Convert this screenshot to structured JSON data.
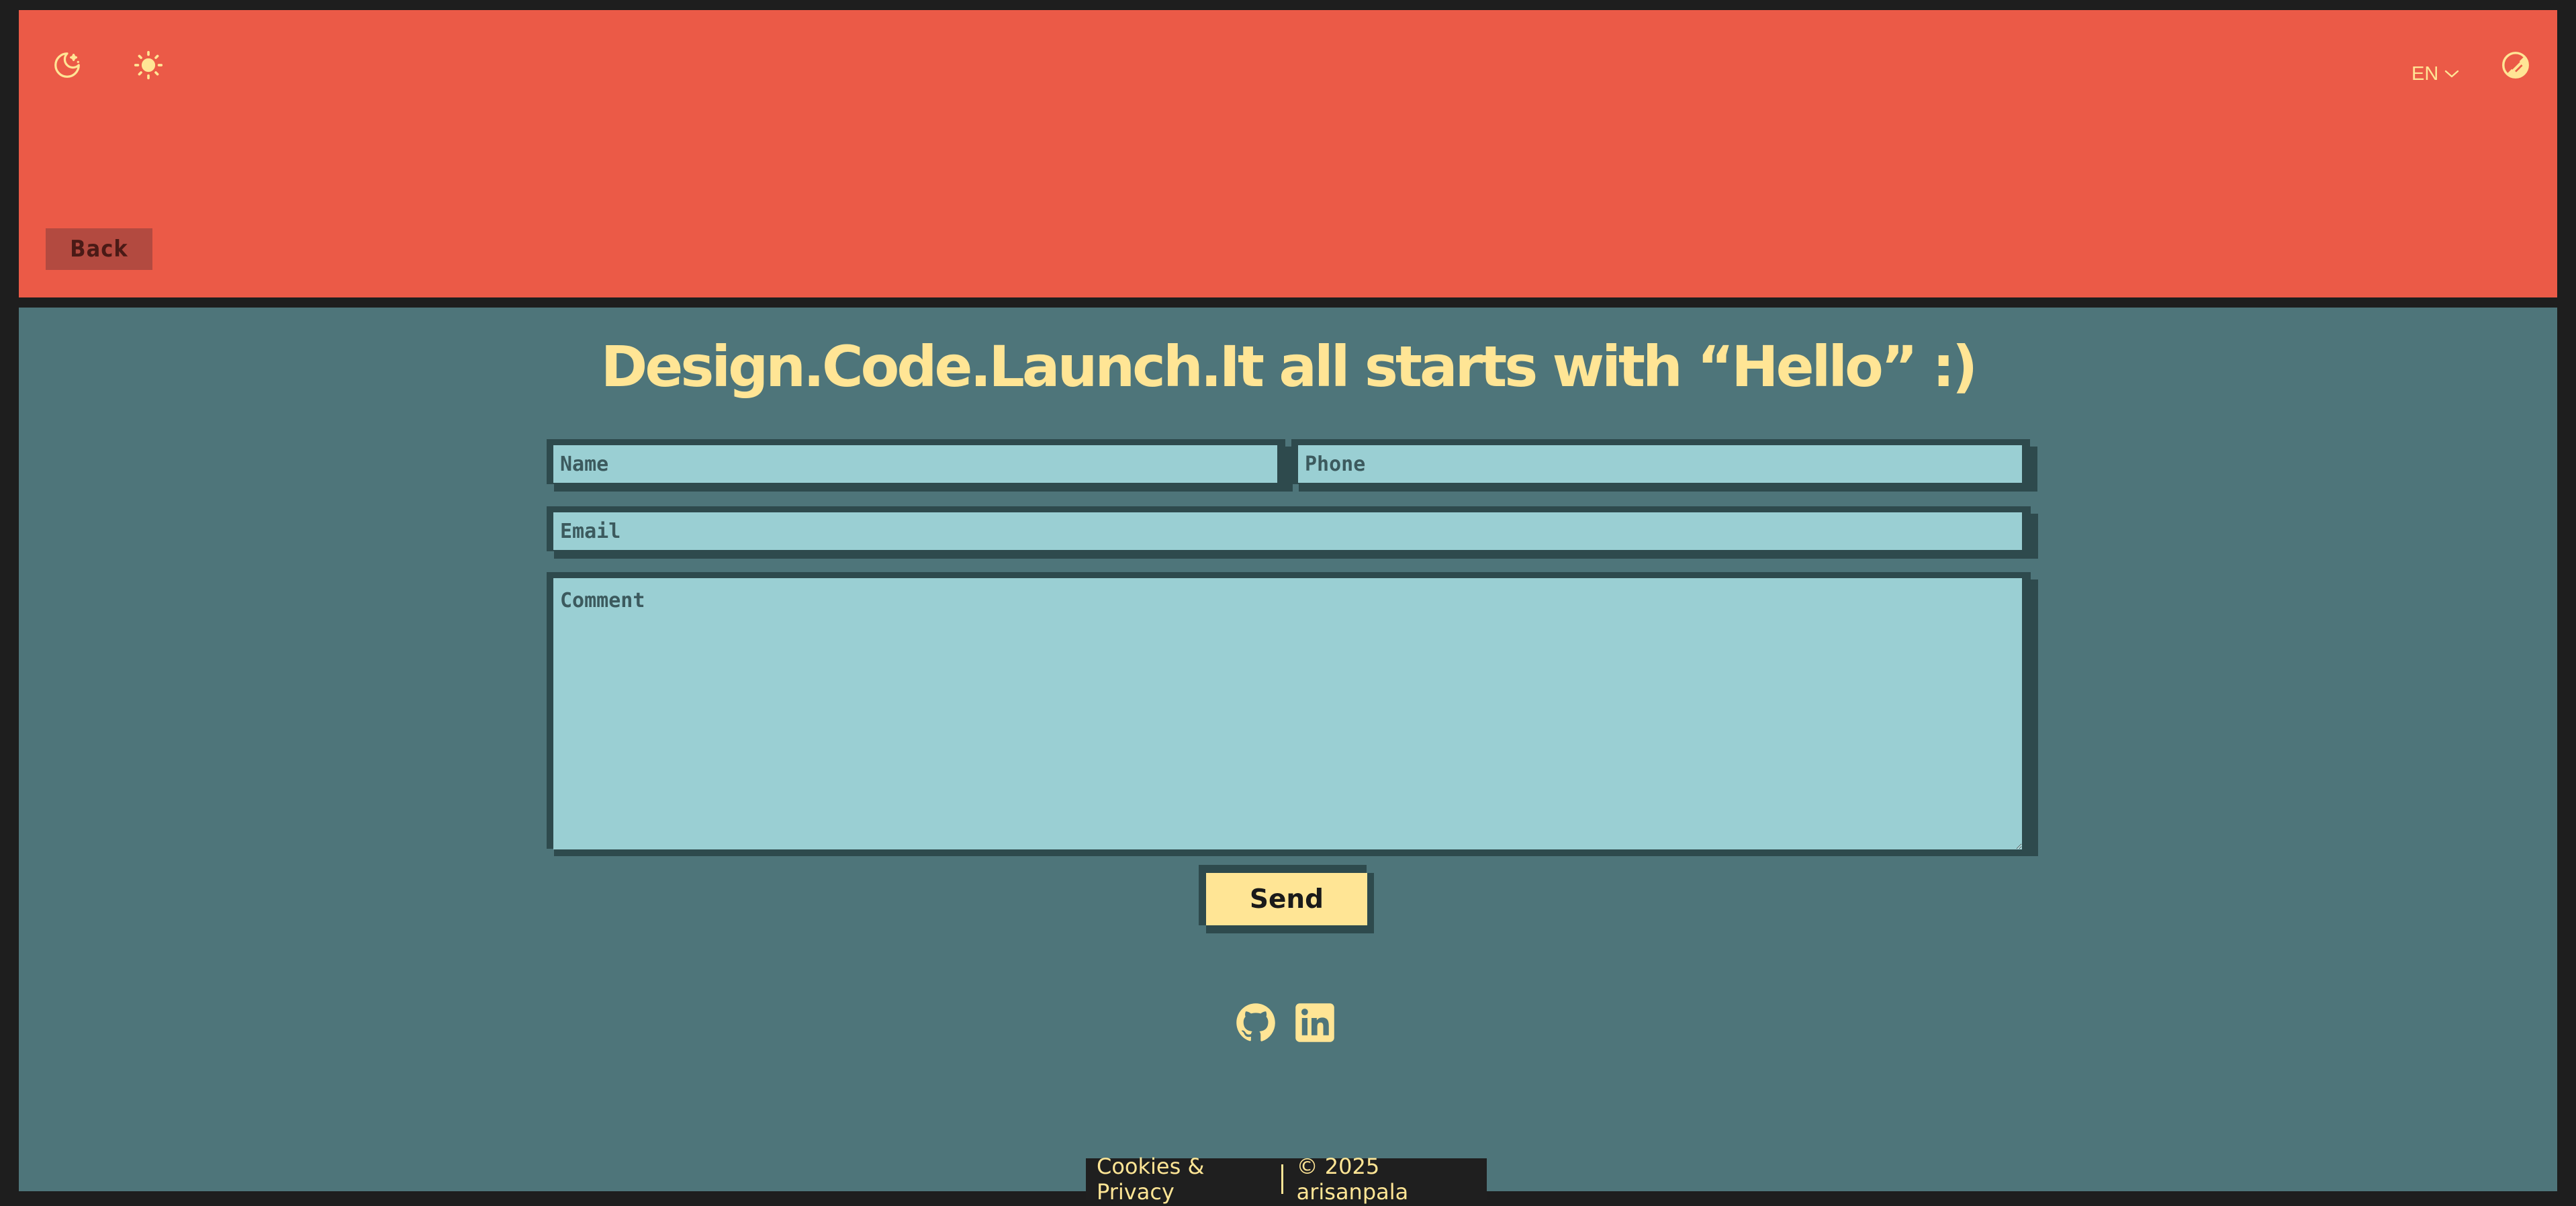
{
  "header": {
    "icons": {
      "night_mode": "moon-stars-icon",
      "light_mode": "sun-icon",
      "contrast": "contrast-icon",
      "language_caret": "chevron-down-icon"
    },
    "language": "EN",
    "back_label": "Back"
  },
  "main": {
    "title": "Design.Code.Launch.It all starts with “Hello” :)",
    "form": {
      "name_placeholder": "Name",
      "phone_placeholder": "Phone",
      "email_placeholder": "Email",
      "comment_placeholder": "Comment",
      "send_label": "Send"
    },
    "socials": [
      "github-icon",
      "linkedin-icon"
    ]
  },
  "footer": {
    "cookies_label": "Cookies & Privacy",
    "copyright": "© 2025 arisanpala"
  },
  "colors": {
    "header_bg": "#eb5a47",
    "main_bg": "#4e757a",
    "accent": "#ffe595",
    "field_bg": "#9acfd3",
    "back_button_bg": "#b34a40"
  }
}
